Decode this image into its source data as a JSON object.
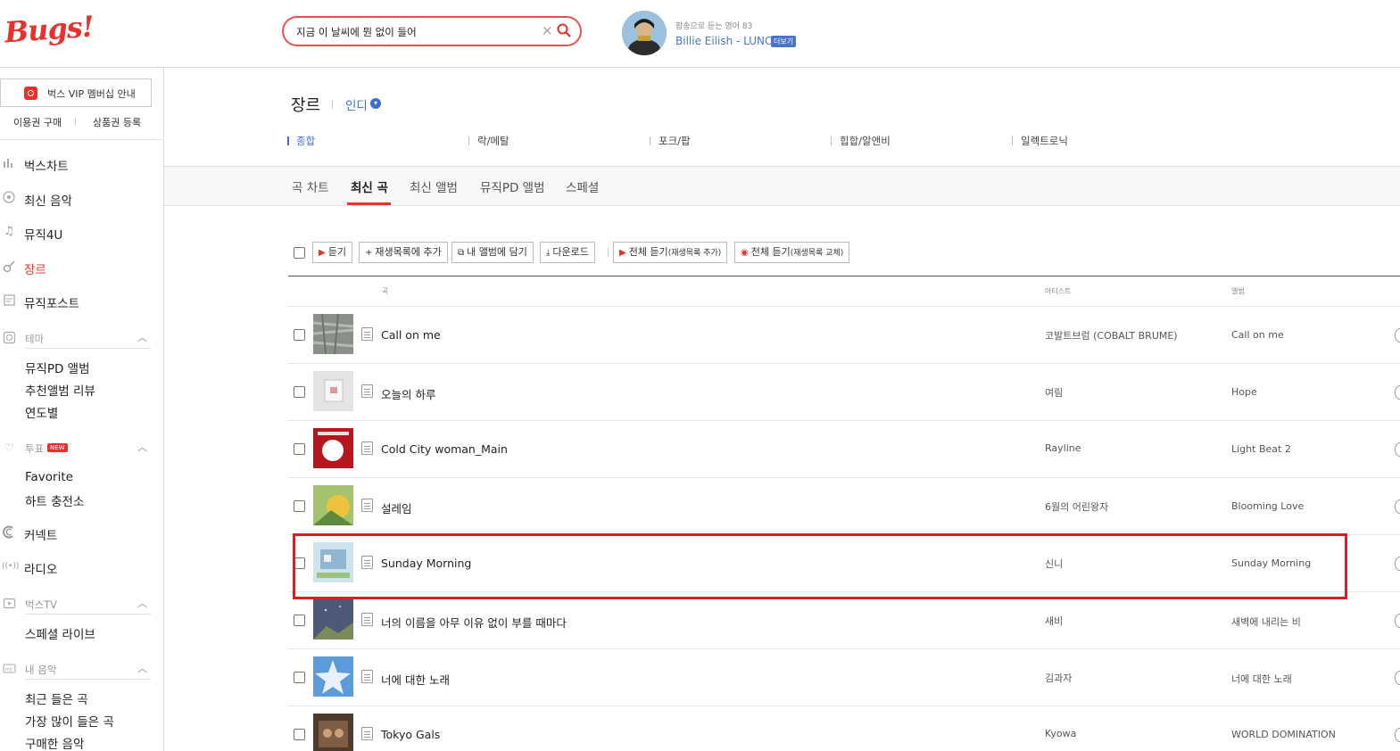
{
  "header": {
    "logo": "Bugs!",
    "search_value": "지금 이 날씨에 뭔 없이 들어",
    "clear_icon": "×",
    "now_playing_sub": "팝송으로 듣는 영어 83",
    "now_playing_title": "Billie Eilish - LUNCH",
    "more_label": "더보기"
  },
  "sidebar": {
    "vip_label": "벅스 VIP 멤버십 안내",
    "buy_pass": "이용권 구매",
    "gift_register": "상품권 등록",
    "nav": [
      {
        "label": "벅스차트",
        "icon": "chart-icon"
      },
      {
        "label": "최신 음악",
        "icon": "new-music-icon"
      },
      {
        "label": "뮤직4U",
        "icon": "music-note-icon"
      },
      {
        "label": "장르",
        "icon": "guitar-icon"
      },
      {
        "label": "뮤직포스트",
        "icon": "post-icon"
      }
    ],
    "theme": {
      "label": "테마",
      "items": [
        "뮤직PD 앨범",
        "추천앨범 리뷰",
        "연도별"
      ]
    },
    "vote": {
      "label": "투표",
      "badge": "NEW",
      "items": [
        "Favorite",
        "하트 충전소"
      ]
    },
    "connect_label": "커넥트",
    "radio_label": "라디오",
    "bugstv": {
      "label": "벅스TV",
      "items": [
        "스페셜 라이브"
      ]
    },
    "mymusic": {
      "label": "내 음악",
      "items": [
        "최근 들은 곡",
        "가장 많이 들은 곡",
        "구매한 음악"
      ]
    }
  },
  "genre": {
    "title": "장르",
    "current": "인디",
    "subgenres": [
      "종합",
      "락/메탈",
      "포크/팝",
      "힙합/알앤비",
      "일렉트로닉"
    ]
  },
  "tabs": [
    "곡 차트",
    "최신 곡",
    "최신 앨범",
    "뮤직PD 앨범",
    "스페셜"
  ],
  "toolbar": {
    "listen": "듣기",
    "add_playlist": "재생목록에 추가",
    "add_album": "내 앨범에 담기",
    "download": "다운로드",
    "play_all_add": "전체 듣기",
    "play_all_add_note": "(재생목록 추가)",
    "play_all_replace": "전체 듣기",
    "play_all_replace_note": "(재생목록 교체)"
  },
  "columns": {
    "song": "곡",
    "artist": "아티스트",
    "album": "앨범"
  },
  "songs": [
    {
      "title": "Call on me",
      "artist": "코발트브럼 (COBALT BRUME)",
      "album": "Call on me"
    },
    {
      "title": "오늘의 하루",
      "artist": "여림",
      "album": "Hope"
    },
    {
      "title": "Cold City woman_Main",
      "artist": "Rayline",
      "album": "Light Beat 2"
    },
    {
      "title": "설레임",
      "artist": "6월의 어린왕자",
      "album": "Blooming Love"
    },
    {
      "title": "Sunday Morning",
      "artist": "신니",
      "album": "Sunday Morning"
    },
    {
      "title": "너의 이름을 아무 이유 없이 부를 때마다",
      "artist": "새비",
      "album": "새벽에 내리는 비"
    },
    {
      "title": "너에 대한 노래",
      "artist": "김과자",
      "album": "너에 대한 노래"
    },
    {
      "title": "Tokyo Gals",
      "artist": "Kyowa",
      "album": "WORLD DOMINATION"
    }
  ],
  "colors": {
    "brand": "#e8302c",
    "accent_blue": "#3e6fc9",
    "highlight": "#d41f26"
  }
}
